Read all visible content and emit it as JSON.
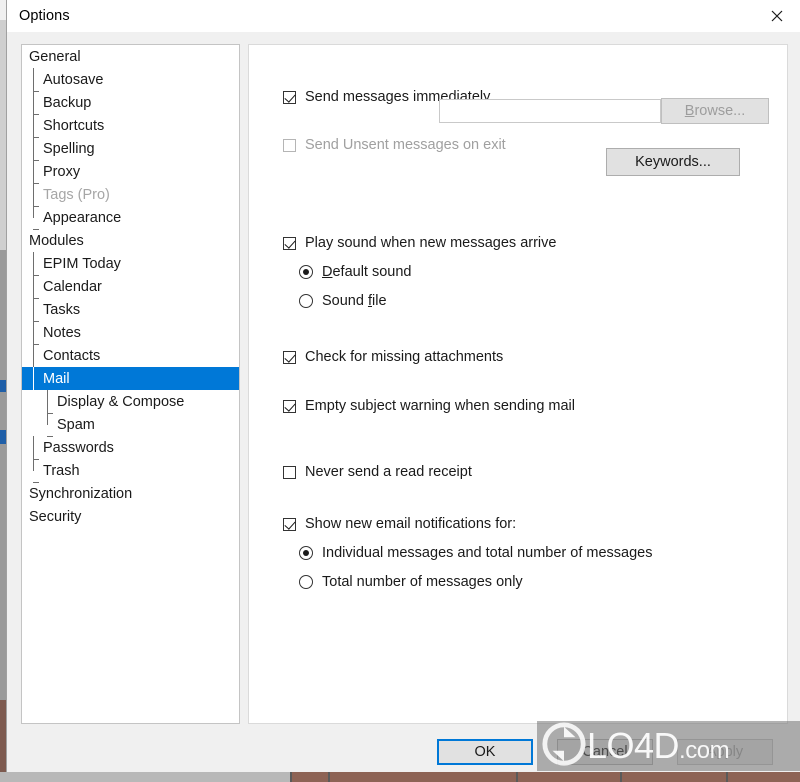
{
  "window": {
    "title": "Options",
    "close_icon": "close-icon"
  },
  "colors": {
    "accent_blue": "#0078d7",
    "selection_blue": "#0078d7",
    "dialog_bg": "#f0f0f0",
    "panel_bg": "#ffffff",
    "button_face": "#e1e1e1",
    "disabled_text": "#a0a0a0",
    "watermark_gray": "#737373"
  },
  "sidebar": {
    "items": [
      {
        "label": "General",
        "level": 0,
        "selected": false,
        "disabled": false,
        "last": false
      },
      {
        "label": "Autosave",
        "level": 1,
        "selected": false,
        "disabled": false,
        "last": false
      },
      {
        "label": "Backup",
        "level": 1,
        "selected": false,
        "disabled": false,
        "last": false
      },
      {
        "label": "Shortcuts",
        "level": 1,
        "selected": false,
        "disabled": false,
        "last": false
      },
      {
        "label": "Spelling",
        "level": 1,
        "selected": false,
        "disabled": false,
        "last": false
      },
      {
        "label": "Proxy",
        "level": 1,
        "selected": false,
        "disabled": false,
        "last": false
      },
      {
        "label": "Tags (Pro)",
        "level": 1,
        "selected": false,
        "disabled": true,
        "last": false
      },
      {
        "label": "Appearance",
        "level": 1,
        "selected": false,
        "disabled": false,
        "last": true
      },
      {
        "label": "Modules",
        "level": 0,
        "selected": false,
        "disabled": false,
        "last": false
      },
      {
        "label": "EPIM Today",
        "level": 1,
        "selected": false,
        "disabled": false,
        "last": false
      },
      {
        "label": "Calendar",
        "level": 1,
        "selected": false,
        "disabled": false,
        "last": false
      },
      {
        "label": "Tasks",
        "level": 1,
        "selected": false,
        "disabled": false,
        "last": false
      },
      {
        "label": "Notes",
        "level": 1,
        "selected": false,
        "disabled": false,
        "last": false
      },
      {
        "label": "Contacts",
        "level": 1,
        "selected": false,
        "disabled": false,
        "last": false
      },
      {
        "label": "Mail",
        "level": 1,
        "selected": true,
        "disabled": false,
        "last": false
      },
      {
        "label": "Display & Compose",
        "level": 2,
        "selected": false,
        "disabled": false,
        "last": false
      },
      {
        "label": "Spam",
        "level": 2,
        "selected": false,
        "disabled": false,
        "last": true
      },
      {
        "label": "Passwords",
        "level": 1,
        "selected": false,
        "disabled": false,
        "last": false
      },
      {
        "label": "Trash",
        "level": 1,
        "selected": false,
        "disabled": false,
        "last": true
      },
      {
        "label": "Synchronization",
        "level": 0,
        "selected": false,
        "disabled": false,
        "last": false
      },
      {
        "label": "Security",
        "level": 0,
        "selected": false,
        "disabled": false,
        "last": false
      }
    ]
  },
  "main": {
    "send_immediately": {
      "label": "Send messages immediately",
      "checked": true,
      "disabled": false
    },
    "send_unsent_on_exit": {
      "label": "Send Unsent messages on exit",
      "checked": false,
      "disabled": true
    },
    "play_sound": {
      "label": "Play sound when new messages arrive",
      "checked": true,
      "disabled": false
    },
    "default_sound": {
      "label_before": "",
      "accel": "D",
      "label_after": "efault sound",
      "selected": true
    },
    "sound_file": {
      "label_before": "Sound ",
      "accel": "f",
      "label_after": "ile",
      "selected": false
    },
    "sound_file_input": {
      "value": "",
      "placeholder": ""
    },
    "browse_button": {
      "accel": "B",
      "label_after": "rowse...",
      "disabled": true
    },
    "check_attachments": {
      "label": "Check for missing attachments",
      "checked": true,
      "disabled": false
    },
    "keywords_button": {
      "label": "Keywords...",
      "disabled": false
    },
    "empty_subject_warning": {
      "label": "Empty subject warning when sending mail",
      "checked": true,
      "disabled": false
    },
    "never_read_receipt": {
      "label": "Never send a read receipt",
      "checked": false,
      "disabled": false
    },
    "show_notifications": {
      "label": "Show new email notifications for:",
      "checked": true,
      "disabled": false
    },
    "notify_individual": {
      "label": "Individual messages and total number of messages",
      "selected": true
    },
    "notify_total_only": {
      "label": "Total number of messages only",
      "selected": false
    }
  },
  "footer": {
    "ok_label": "OK",
    "cancel_label": "Cancel",
    "apply_label": "Apply"
  },
  "watermark": {
    "text": "LO4D",
    "suffix": ".com",
    "logo_icon": "refresh-circle-icon"
  }
}
